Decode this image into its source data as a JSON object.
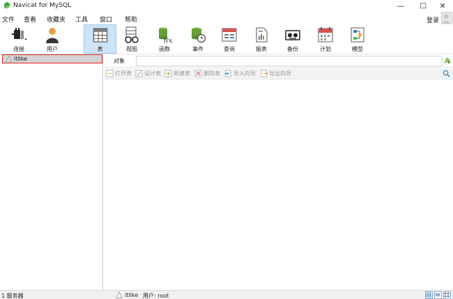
{
  "window": {
    "title": "Navicat for MySQL",
    "minimize": "—",
    "maximize": "☐",
    "close": "✕"
  },
  "menu": [
    "文件",
    "查看",
    "收藏夹",
    "工具",
    "窗口",
    "帮助"
  ],
  "login": "登录",
  "toolbar": {
    "connect": "连接",
    "user": "用户",
    "table": "表",
    "view": "视图",
    "function": "函数",
    "event": "事件",
    "query": "查询",
    "report": "报表",
    "backup": "备份",
    "schedule": "计划",
    "model": "模型"
  },
  "connections": [
    {
      "name": "itlike"
    }
  ],
  "object_tab": "对象",
  "object_toolbar": [
    "打开表",
    "设计表",
    "新建表",
    "删除表",
    "导入向导",
    "导出向导"
  ],
  "status": {
    "servers": "1 服务器",
    "connection": "itlike",
    "user": "用户: root"
  },
  "colors": {
    "active_tool": "#cde3f7",
    "selection_border": "#e0241b"
  }
}
